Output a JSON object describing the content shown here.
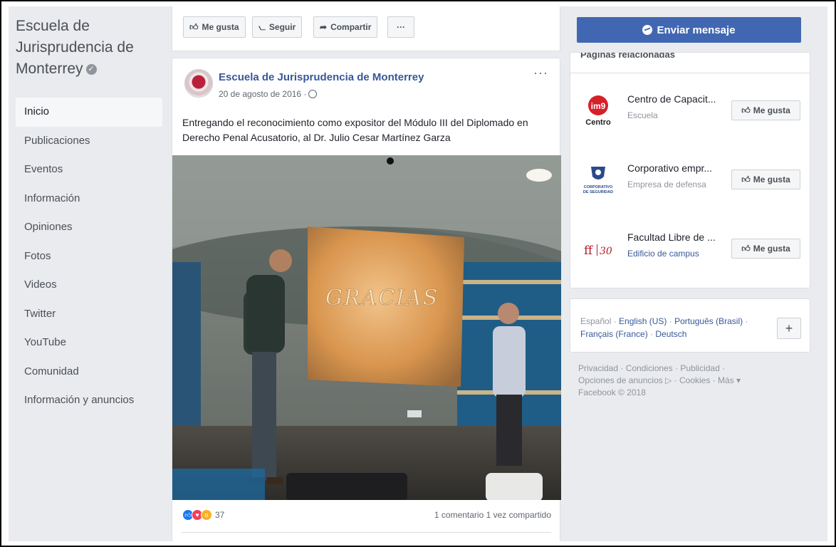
{
  "left": {
    "page_name": "Escuela de Jurisprudencia de Monterrey",
    "nav": [
      "Inicio",
      "Publicaciones",
      "Eventos",
      "Información",
      "Opiniones",
      "Fotos",
      "Videos",
      "Twitter",
      "YouTube",
      "Comunidad",
      "Información y anuncios"
    ]
  },
  "toolbar": {
    "like": "Me gusta",
    "follow": "Seguir",
    "share": "Compartir",
    "more": "···"
  },
  "post": {
    "author": "Escuela de Jurisprudencia de Monterrey",
    "date": "20 de agosto de 2016 ·",
    "more": "···",
    "text": "Entregando el reconocimiento como expositor del Módulo III del Diplomado en Derecho Penal Acusatorio, al Dr. Julio Cesar Martínez Garza",
    "photo_slide_text": "GRACIAS",
    "reaction_count": "37",
    "comments": "1 comentario",
    "shares": "1 vez compartido"
  },
  "right": {
    "send_message": "Enviar mensaje",
    "related_title": "Páginas relacionadas",
    "related": [
      {
        "name": "Centro de Capacit...",
        "category": "Escuela",
        "logo_text": "im9",
        "logo_sub": "Centro",
        "button": "Me gusta"
      },
      {
        "name": "Corporativo empr...",
        "category": "Empresa de defensa",
        "logo_text": "CORPORATIVO DE SEGURIDAD",
        "button": "Me gusta"
      },
      {
        "name": "Facultad Libre de ...",
        "category": "Edificio de campus",
        "logo_text": "30",
        "button": "Me gusta"
      }
    ],
    "languages": {
      "current": "Español ·",
      "english": "English (US)",
      "sep1": " · ",
      "portuguese": "Português (Brasil)",
      "sep2": " · ",
      "french": "Français (France)",
      "sep3": " · ",
      "german": "Deutsch",
      "plus": "+"
    },
    "footer_line1": "Privacidad · Condiciones · Publicidad ·",
    "footer_line2": "Opciones de anuncios ▷ · Cookies · Más ▾",
    "footer_line3": "Facebook © 2018"
  },
  "colors": {
    "brand": "#4267b2",
    "link": "#385898",
    "background": "#e9ebee"
  }
}
